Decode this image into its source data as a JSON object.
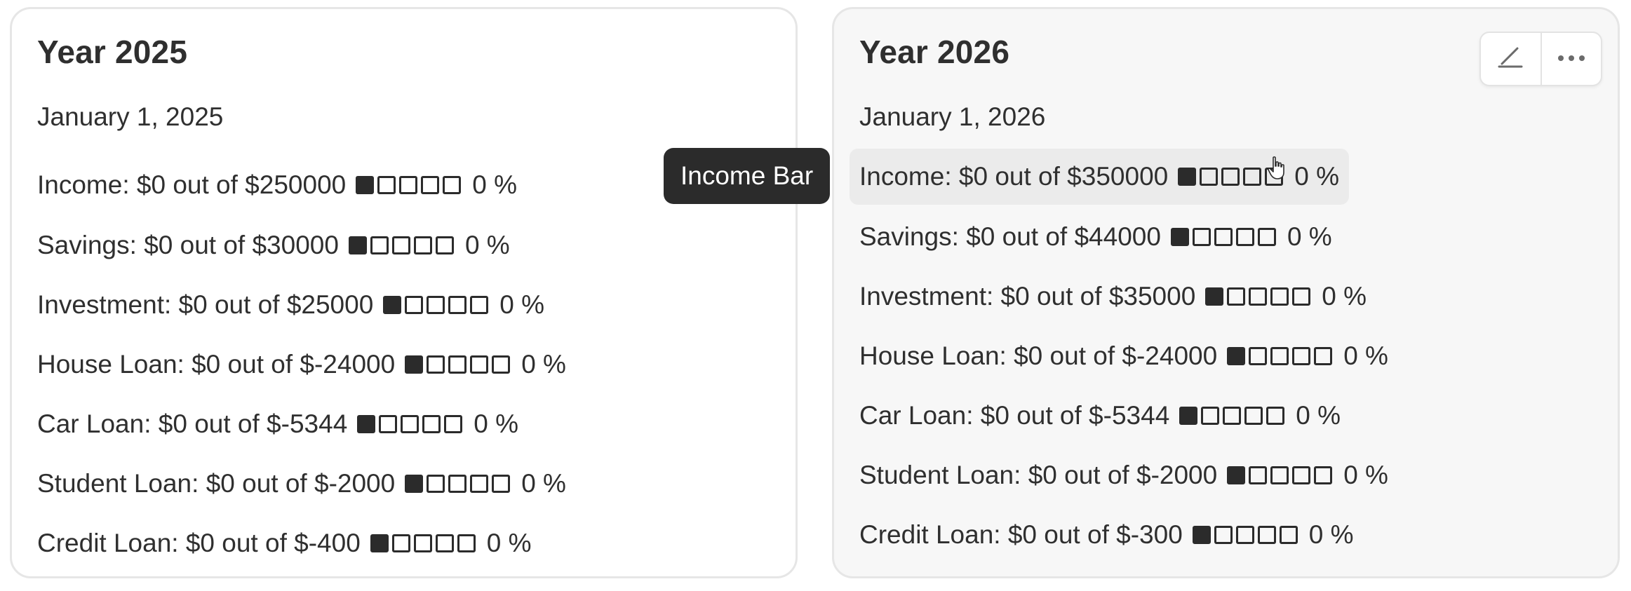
{
  "cards": [
    {
      "title": "Year 2025",
      "date": "January 1, 2025",
      "rows": [
        {
          "label": "Income: $0 out of $250000",
          "percent": "0 %",
          "progress": 0
        },
        {
          "label": "Savings: $0 out of $30000",
          "percent": "0 %",
          "progress": 0
        },
        {
          "label": "Investment: $0 out of $25000",
          "percent": "0 %",
          "progress": 0
        },
        {
          "label": "House Loan: $0 out of $-24000",
          "percent": "0 %",
          "progress": 0
        },
        {
          "label": "Car Loan: $0 out of $-5344",
          "percent": "0 %",
          "progress": 0
        },
        {
          "label": "Student Loan: $0 out of $-2000",
          "percent": "0 %",
          "progress": 0
        },
        {
          "label": "Credit Loan: $0 out of $-400",
          "percent": "0 %",
          "progress": 0
        }
      ]
    },
    {
      "title": "Year 2026",
      "date": "January 1, 2026",
      "rows": [
        {
          "label": "Income: $0 out of $350000",
          "percent": "0 %",
          "progress": 0
        },
        {
          "label": "Savings: $0 out of $44000",
          "percent": "0 %",
          "progress": 0
        },
        {
          "label": "Investment: $0 out of $35000",
          "percent": "0 %",
          "progress": 0
        },
        {
          "label": "House Loan: $0 out of $-24000",
          "percent": "0 %",
          "progress": 0
        },
        {
          "label": "Car Loan: $0 out of $-5344",
          "percent": "0 %",
          "progress": 0
        },
        {
          "label": "Student Loan: $0 out of $-2000",
          "percent": "0 %",
          "progress": 0
        },
        {
          "label": "Credit Loan: $0 out of $-300",
          "percent": "0 %",
          "progress": 0
        }
      ]
    }
  ],
  "tooltip": {
    "text": "Income Bar"
  },
  "toolbar": {
    "icons": [
      "edit-icon",
      "more-icon"
    ]
  },
  "colors": {
    "bar": "#2b2b2b",
    "tooltip_bg": "#2b2b2b",
    "hover_row": "#ebebeb"
  }
}
